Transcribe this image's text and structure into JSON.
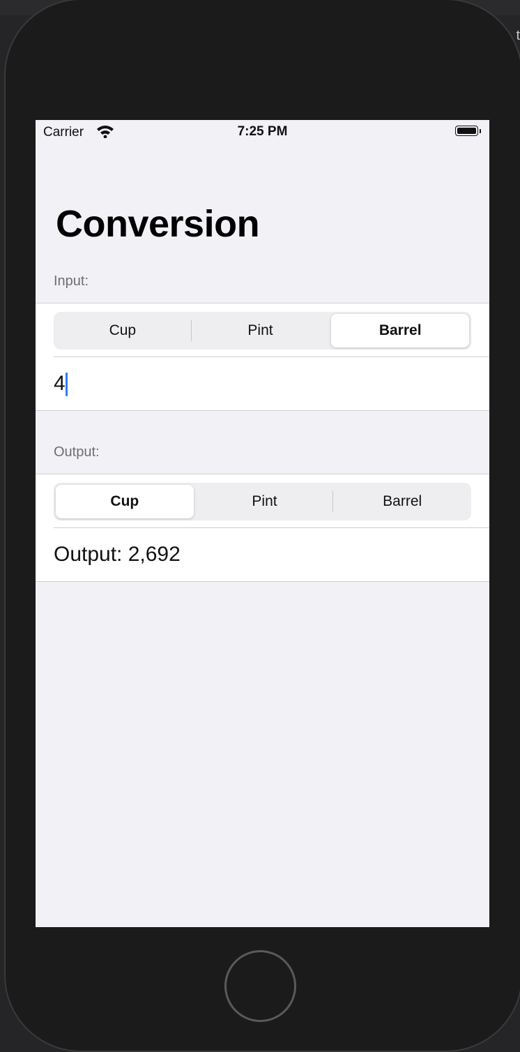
{
  "status_bar": {
    "carrier": "Carrier",
    "time": "7:25 PM"
  },
  "nav": {
    "title": "Conversion"
  },
  "input_section": {
    "header": "Input:",
    "units": [
      "Cup",
      "Pint",
      "Barrel"
    ],
    "selected_unit": "Barrel",
    "value": "4"
  },
  "output_section": {
    "header": "Output:",
    "units": [
      "Cup",
      "Pint",
      "Barrel"
    ],
    "selected_unit": "Cup",
    "result_text": "Output: 2,692"
  },
  "colors": {
    "accent": "#2f7cf6",
    "background": "#f1f1f6",
    "bezel": "#1b1b1c"
  }
}
